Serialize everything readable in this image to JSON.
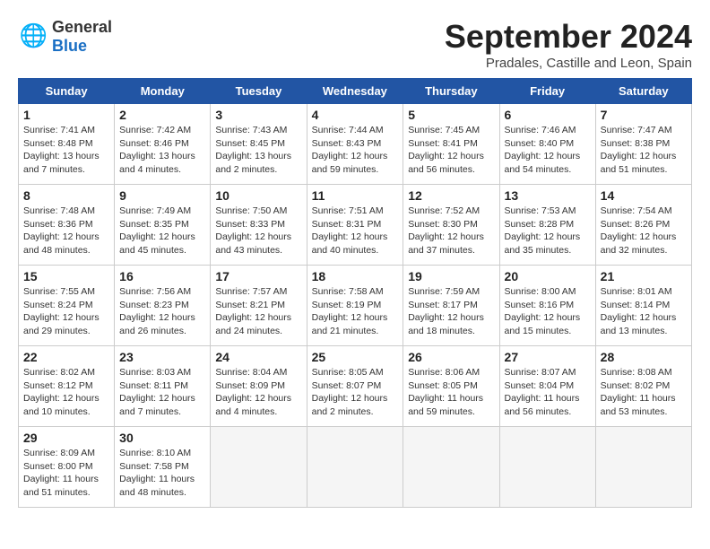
{
  "logo": {
    "general": "General",
    "blue": "Blue"
  },
  "title": "September 2024",
  "subtitle": "Pradales, Castille and Leon, Spain",
  "days_header": [
    "Sunday",
    "Monday",
    "Tuesday",
    "Wednesday",
    "Thursday",
    "Friday",
    "Saturday"
  ],
  "weeks": [
    [
      {
        "day": "1",
        "sunrise": "Sunrise: 7:41 AM",
        "sunset": "Sunset: 8:48 PM",
        "daylight": "Daylight: 13 hours and 7 minutes."
      },
      {
        "day": "2",
        "sunrise": "Sunrise: 7:42 AM",
        "sunset": "Sunset: 8:46 PM",
        "daylight": "Daylight: 13 hours and 4 minutes."
      },
      {
        "day": "3",
        "sunrise": "Sunrise: 7:43 AM",
        "sunset": "Sunset: 8:45 PM",
        "daylight": "Daylight: 13 hours and 2 minutes."
      },
      {
        "day": "4",
        "sunrise": "Sunrise: 7:44 AM",
        "sunset": "Sunset: 8:43 PM",
        "daylight": "Daylight: 12 hours and 59 minutes."
      },
      {
        "day": "5",
        "sunrise": "Sunrise: 7:45 AM",
        "sunset": "Sunset: 8:41 PM",
        "daylight": "Daylight: 12 hours and 56 minutes."
      },
      {
        "day": "6",
        "sunrise": "Sunrise: 7:46 AM",
        "sunset": "Sunset: 8:40 PM",
        "daylight": "Daylight: 12 hours and 54 minutes."
      },
      {
        "day": "7",
        "sunrise": "Sunrise: 7:47 AM",
        "sunset": "Sunset: 8:38 PM",
        "daylight": "Daylight: 12 hours and 51 minutes."
      }
    ],
    [
      {
        "day": "8",
        "sunrise": "Sunrise: 7:48 AM",
        "sunset": "Sunset: 8:36 PM",
        "daylight": "Daylight: 12 hours and 48 minutes."
      },
      {
        "day": "9",
        "sunrise": "Sunrise: 7:49 AM",
        "sunset": "Sunset: 8:35 PM",
        "daylight": "Daylight: 12 hours and 45 minutes."
      },
      {
        "day": "10",
        "sunrise": "Sunrise: 7:50 AM",
        "sunset": "Sunset: 8:33 PM",
        "daylight": "Daylight: 12 hours and 43 minutes."
      },
      {
        "day": "11",
        "sunrise": "Sunrise: 7:51 AM",
        "sunset": "Sunset: 8:31 PM",
        "daylight": "Daylight: 12 hours and 40 minutes."
      },
      {
        "day": "12",
        "sunrise": "Sunrise: 7:52 AM",
        "sunset": "Sunset: 8:30 PM",
        "daylight": "Daylight: 12 hours and 37 minutes."
      },
      {
        "day": "13",
        "sunrise": "Sunrise: 7:53 AM",
        "sunset": "Sunset: 8:28 PM",
        "daylight": "Daylight: 12 hours and 35 minutes."
      },
      {
        "day": "14",
        "sunrise": "Sunrise: 7:54 AM",
        "sunset": "Sunset: 8:26 PM",
        "daylight": "Daylight: 12 hours and 32 minutes."
      }
    ],
    [
      {
        "day": "15",
        "sunrise": "Sunrise: 7:55 AM",
        "sunset": "Sunset: 8:24 PM",
        "daylight": "Daylight: 12 hours and 29 minutes."
      },
      {
        "day": "16",
        "sunrise": "Sunrise: 7:56 AM",
        "sunset": "Sunset: 8:23 PM",
        "daylight": "Daylight: 12 hours and 26 minutes."
      },
      {
        "day": "17",
        "sunrise": "Sunrise: 7:57 AM",
        "sunset": "Sunset: 8:21 PM",
        "daylight": "Daylight: 12 hours and 24 minutes."
      },
      {
        "day": "18",
        "sunrise": "Sunrise: 7:58 AM",
        "sunset": "Sunset: 8:19 PM",
        "daylight": "Daylight: 12 hours and 21 minutes."
      },
      {
        "day": "19",
        "sunrise": "Sunrise: 7:59 AM",
        "sunset": "Sunset: 8:17 PM",
        "daylight": "Daylight: 12 hours and 18 minutes."
      },
      {
        "day": "20",
        "sunrise": "Sunrise: 8:00 AM",
        "sunset": "Sunset: 8:16 PM",
        "daylight": "Daylight: 12 hours and 15 minutes."
      },
      {
        "day": "21",
        "sunrise": "Sunrise: 8:01 AM",
        "sunset": "Sunset: 8:14 PM",
        "daylight": "Daylight: 12 hours and 13 minutes."
      }
    ],
    [
      {
        "day": "22",
        "sunrise": "Sunrise: 8:02 AM",
        "sunset": "Sunset: 8:12 PM",
        "daylight": "Daylight: 12 hours and 10 minutes."
      },
      {
        "day": "23",
        "sunrise": "Sunrise: 8:03 AM",
        "sunset": "Sunset: 8:11 PM",
        "daylight": "Daylight: 12 hours and 7 minutes."
      },
      {
        "day": "24",
        "sunrise": "Sunrise: 8:04 AM",
        "sunset": "Sunset: 8:09 PM",
        "daylight": "Daylight: 12 hours and 4 minutes."
      },
      {
        "day": "25",
        "sunrise": "Sunrise: 8:05 AM",
        "sunset": "Sunset: 8:07 PM",
        "daylight": "Daylight: 12 hours and 2 minutes."
      },
      {
        "day": "26",
        "sunrise": "Sunrise: 8:06 AM",
        "sunset": "Sunset: 8:05 PM",
        "daylight": "Daylight: 11 hours and 59 minutes."
      },
      {
        "day": "27",
        "sunrise": "Sunrise: 8:07 AM",
        "sunset": "Sunset: 8:04 PM",
        "daylight": "Daylight: 11 hours and 56 minutes."
      },
      {
        "day": "28",
        "sunrise": "Sunrise: 8:08 AM",
        "sunset": "Sunset: 8:02 PM",
        "daylight": "Daylight: 11 hours and 53 minutes."
      }
    ],
    [
      {
        "day": "29",
        "sunrise": "Sunrise: 8:09 AM",
        "sunset": "Sunset: 8:00 PM",
        "daylight": "Daylight: 11 hours and 51 minutes."
      },
      {
        "day": "30",
        "sunrise": "Sunrise: 8:10 AM",
        "sunset": "Sunset: 7:58 PM",
        "daylight": "Daylight: 11 hours and 48 minutes."
      },
      null,
      null,
      null,
      null,
      null
    ]
  ]
}
